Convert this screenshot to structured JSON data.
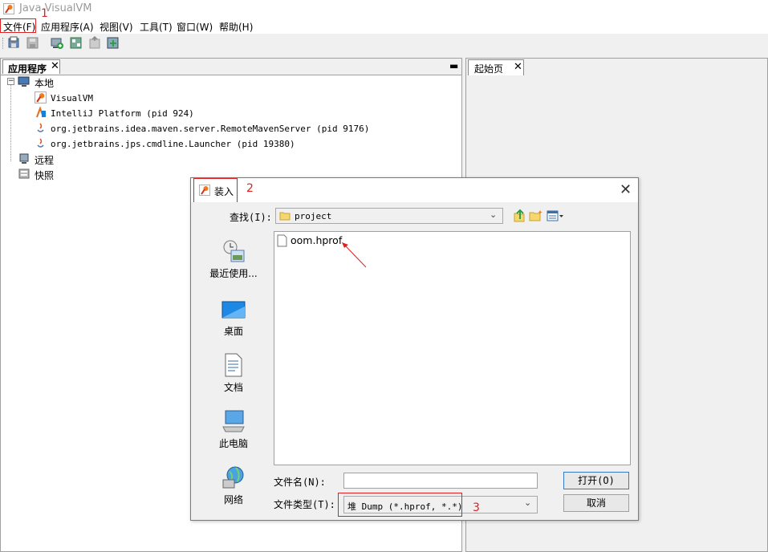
{
  "window": {
    "title": "Java VisualVM"
  },
  "menu": [
    "文件(F)",
    "应用程序(A)",
    "视图(V)",
    "工具(T)",
    "窗口(W)",
    "帮助(H)"
  ],
  "left_panel": {
    "tab_label": "应用程序",
    "tree": {
      "local": "本地",
      "apps": [
        "VisualVM",
        "IntelliJ Platform (pid 924)",
        "org.jetbrains.idea.maven.server.RemoteMavenServer (pid 9176)",
        "org.jetbrains.jps.cmdline.Launcher (pid 19380)"
      ],
      "remote": "远程",
      "snapshots": "快照"
    }
  },
  "right_panel": {
    "tab_label": "起始页"
  },
  "dialog": {
    "title": "装入",
    "look_in_label": "查找(I):",
    "look_in_value": "project",
    "places": [
      "最近使用...",
      "桌面",
      "文档",
      "此电脑",
      "网络"
    ],
    "files": [
      "oom.hprof"
    ],
    "filename_label": "文件名(N):",
    "filename_value": "",
    "filetype_label": "文件类型(T):",
    "filetype_value": "堆 Dump (*.hprof, *.*)",
    "open_button": "打开(O)",
    "cancel_button": "取消"
  },
  "annotations": {
    "step1": "1",
    "step2": "2",
    "step3": "3",
    "color": "#e02020"
  }
}
